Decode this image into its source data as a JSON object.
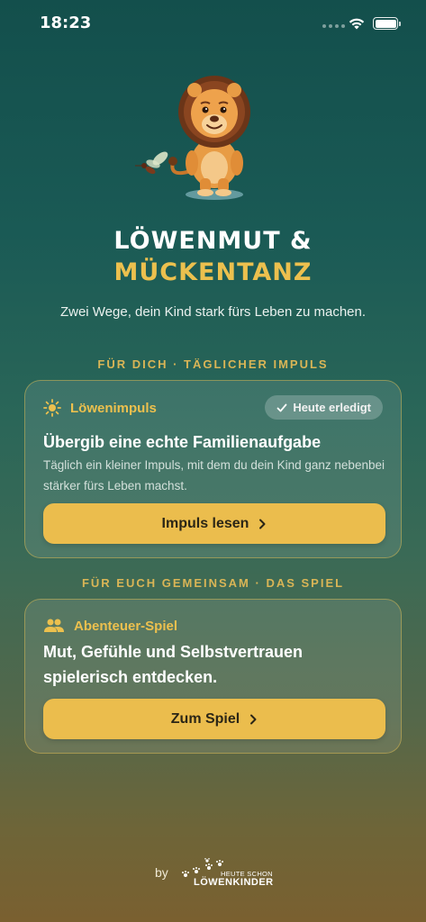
{
  "status_bar": {
    "time": "18:23"
  },
  "header": {
    "title_line1": "LÖWENMUT &",
    "title_line2": "MÜCKENTANZ",
    "subtitle": "Zwei Wege, dein Kind stark fürs Leben zu machen."
  },
  "section_daily": {
    "label": "FÜR DICH · TÄGLICHER IMPULS",
    "card": {
      "icon": "sun-icon",
      "heading": "Löwenimpuls",
      "badge": "Heute erledigt",
      "title": "Übergib eine echte Familienaufgabe",
      "text": "Täglich ein kleiner Impuls, mit dem du dein Kind ganz nebenbei stärker fürs Leben machst.",
      "button_label": "Impuls lesen"
    }
  },
  "section_game": {
    "label": "FÜR EUCH GEMEINSAM · DAS SPIEL",
    "card": {
      "icon": "people-icon",
      "heading": "Abenteuer-Spiel",
      "title": "Mut, Gefühle und Selbstvertrauen spielerisch entdecken.",
      "button_label": "Zum Spiel"
    }
  },
  "footer": {
    "by": "by",
    "logo_small": "HEUTE SCHON",
    "logo_big": "LÖWENKINDER"
  },
  "colors": {
    "accent": "#ecc04e",
    "button": "#ebbd4d",
    "background_top": "#134f4c",
    "background_bottom": "#7a6030"
  }
}
